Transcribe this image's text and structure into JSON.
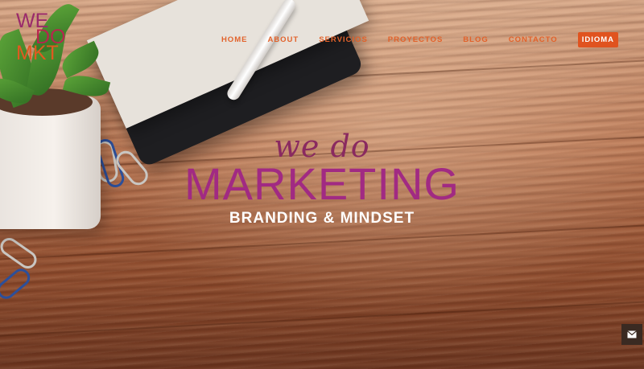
{
  "logo": {
    "line1": "WE",
    "line2": "DO",
    "line3": "MKT"
  },
  "nav": {
    "items": [
      {
        "label": "HOME"
      },
      {
        "label": "ABOUT"
      },
      {
        "label": "SERVICIOS"
      },
      {
        "label": "PROYECTOS"
      },
      {
        "label": "BLOG"
      },
      {
        "label": "CONTACTO"
      }
    ],
    "language_button": "IDIOMA"
  },
  "hero": {
    "tagline_small": "we do",
    "tagline_big": "MARKETING",
    "subtitle": "BRANDING & MINDSET"
  },
  "icons": {
    "contact": "envelope-icon"
  },
  "colors": {
    "accent": "#e0531f",
    "magenta": "#a12a83",
    "plum": "#8a2a60"
  }
}
